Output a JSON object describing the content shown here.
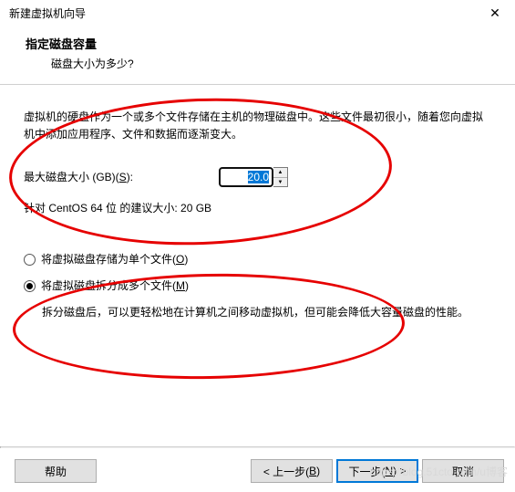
{
  "window": {
    "title": "新建虚拟机向导",
    "close_icon": "✕"
  },
  "header": {
    "title": "指定磁盘容量",
    "subtitle": "磁盘大小为多少?"
  },
  "body": {
    "description": "虚拟机的硬盘作为一个或多个文件存储在主机的物理磁盘中。这些文件最初很小，随着您向虚拟机中添加应用程序、文件和数据而逐渐变大。",
    "size_label_pre": "最大磁盘大小 (GB)(",
    "size_label_hk": "S",
    "size_label_post": "):",
    "size_value": "20.0",
    "recommend": "针对 CentOS 64 位 的建议大小: 20 GB",
    "radio_single_pre": "将虚拟磁盘存储为单个文件(",
    "radio_single_hk": "O",
    "radio_single_post": ")",
    "radio_split_pre": "将虚拟磁盘拆分成多个文件(",
    "radio_split_hk": "M",
    "radio_split_post": ")",
    "split_note": "拆分磁盘后，可以更轻松地在计算机之间移动虚拟机，但可能会降低大容量磁盘的性能。"
  },
  "buttons": {
    "help": "帮助",
    "back_pre": "< 上一步(",
    "back_hk": "B",
    "back_post": ")",
    "next_pre": "下一步(",
    "next_hk": "N",
    "next_post": ") >",
    "cancel": "取消"
  },
  "icons": {
    "spin_up": "▲",
    "spin_down": "▼"
  },
  "watermark": "https://blog.51cto.com/u博客"
}
